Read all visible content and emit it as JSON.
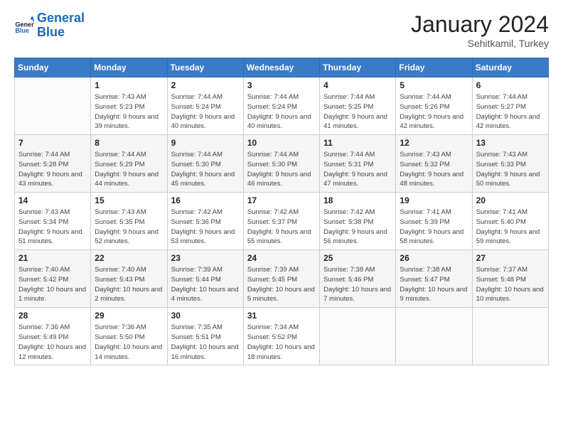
{
  "header": {
    "logo_general": "General",
    "logo_blue": "Blue",
    "month_year": "January 2024",
    "location": "Sehitkamil, Turkey"
  },
  "days_of_week": [
    "Sunday",
    "Monday",
    "Tuesday",
    "Wednesday",
    "Thursday",
    "Friday",
    "Saturday"
  ],
  "weeks": [
    [
      {
        "day": "",
        "info": ""
      },
      {
        "day": "1",
        "info": "Sunrise: 7:43 AM\nSunset: 5:23 PM\nDaylight: 9 hours and 39 minutes."
      },
      {
        "day": "2",
        "info": "Sunrise: 7:44 AM\nSunset: 5:24 PM\nDaylight: 9 hours and 40 minutes."
      },
      {
        "day": "3",
        "info": "Sunrise: 7:44 AM\nSunset: 5:24 PM\nDaylight: 9 hours and 40 minutes."
      },
      {
        "day": "4",
        "info": "Sunrise: 7:44 AM\nSunset: 5:25 PM\nDaylight: 9 hours and 41 minutes."
      },
      {
        "day": "5",
        "info": "Sunrise: 7:44 AM\nSunset: 5:26 PM\nDaylight: 9 hours and 42 minutes."
      },
      {
        "day": "6",
        "info": "Sunrise: 7:44 AM\nSunset: 5:27 PM\nDaylight: 9 hours and 42 minutes."
      }
    ],
    [
      {
        "day": "7",
        "info": "Sunrise: 7:44 AM\nSunset: 5:28 PM\nDaylight: 9 hours and 43 minutes."
      },
      {
        "day": "8",
        "info": "Sunrise: 7:44 AM\nSunset: 5:29 PM\nDaylight: 9 hours and 44 minutes."
      },
      {
        "day": "9",
        "info": "Sunrise: 7:44 AM\nSunset: 5:30 PM\nDaylight: 9 hours and 45 minutes."
      },
      {
        "day": "10",
        "info": "Sunrise: 7:44 AM\nSunset: 5:30 PM\nDaylight: 9 hours and 46 minutes."
      },
      {
        "day": "11",
        "info": "Sunrise: 7:44 AM\nSunset: 5:31 PM\nDaylight: 9 hours and 47 minutes."
      },
      {
        "day": "12",
        "info": "Sunrise: 7:43 AM\nSunset: 5:32 PM\nDaylight: 9 hours and 48 minutes."
      },
      {
        "day": "13",
        "info": "Sunrise: 7:43 AM\nSunset: 5:33 PM\nDaylight: 9 hours and 50 minutes."
      }
    ],
    [
      {
        "day": "14",
        "info": "Sunrise: 7:43 AM\nSunset: 5:34 PM\nDaylight: 9 hours and 51 minutes."
      },
      {
        "day": "15",
        "info": "Sunrise: 7:43 AM\nSunset: 5:35 PM\nDaylight: 9 hours and 52 minutes."
      },
      {
        "day": "16",
        "info": "Sunrise: 7:42 AM\nSunset: 5:36 PM\nDaylight: 9 hours and 53 minutes."
      },
      {
        "day": "17",
        "info": "Sunrise: 7:42 AM\nSunset: 5:37 PM\nDaylight: 9 hours and 55 minutes."
      },
      {
        "day": "18",
        "info": "Sunrise: 7:42 AM\nSunset: 5:38 PM\nDaylight: 9 hours and 56 minutes."
      },
      {
        "day": "19",
        "info": "Sunrise: 7:41 AM\nSunset: 5:39 PM\nDaylight: 9 hours and 58 minutes."
      },
      {
        "day": "20",
        "info": "Sunrise: 7:41 AM\nSunset: 5:40 PM\nDaylight: 9 hours and 59 minutes."
      }
    ],
    [
      {
        "day": "21",
        "info": "Sunrise: 7:40 AM\nSunset: 5:42 PM\nDaylight: 10 hours and 1 minute."
      },
      {
        "day": "22",
        "info": "Sunrise: 7:40 AM\nSunset: 5:43 PM\nDaylight: 10 hours and 2 minutes."
      },
      {
        "day": "23",
        "info": "Sunrise: 7:39 AM\nSunset: 5:44 PM\nDaylight: 10 hours and 4 minutes."
      },
      {
        "day": "24",
        "info": "Sunrise: 7:39 AM\nSunset: 5:45 PM\nDaylight: 10 hours and 5 minutes."
      },
      {
        "day": "25",
        "info": "Sunrise: 7:38 AM\nSunset: 5:46 PM\nDaylight: 10 hours and 7 minutes."
      },
      {
        "day": "26",
        "info": "Sunrise: 7:38 AM\nSunset: 5:47 PM\nDaylight: 10 hours and 9 minutes."
      },
      {
        "day": "27",
        "info": "Sunrise: 7:37 AM\nSunset: 5:48 PM\nDaylight: 10 hours and 10 minutes."
      }
    ],
    [
      {
        "day": "28",
        "info": "Sunrise: 7:36 AM\nSunset: 5:49 PM\nDaylight: 10 hours and 12 minutes."
      },
      {
        "day": "29",
        "info": "Sunrise: 7:36 AM\nSunset: 5:50 PM\nDaylight: 10 hours and 14 minutes."
      },
      {
        "day": "30",
        "info": "Sunrise: 7:35 AM\nSunset: 5:51 PM\nDaylight: 10 hours and 16 minutes."
      },
      {
        "day": "31",
        "info": "Sunrise: 7:34 AM\nSunset: 5:52 PM\nDaylight: 10 hours and 18 minutes."
      },
      {
        "day": "",
        "info": ""
      },
      {
        "day": "",
        "info": ""
      },
      {
        "day": "",
        "info": ""
      }
    ]
  ]
}
